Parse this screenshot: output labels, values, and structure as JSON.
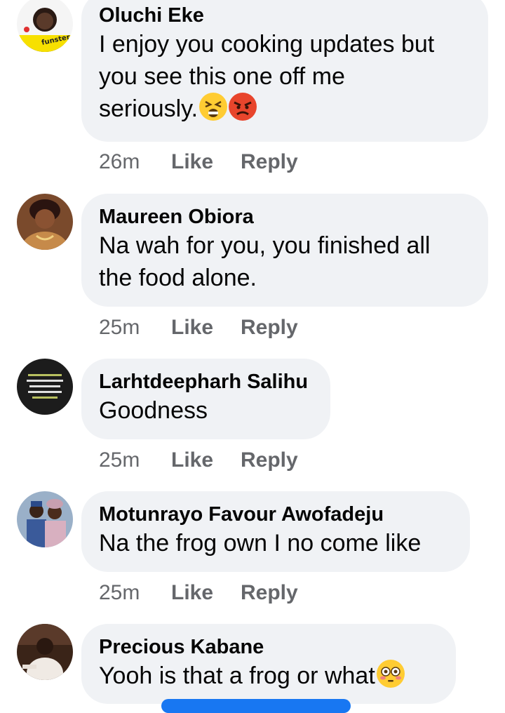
{
  "comments": [
    {
      "name": "Oluchi Eke",
      "text_lines": [
        "I enjoy you cooking updates but",
        "you see this one off me",
        "seriously."
      ],
      "emojis": [
        "tired-face-emoji",
        "angry-face-emoji"
      ],
      "time": "26m",
      "like": "Like",
      "reply": "Reply",
      "avatar": {
        "bg": "#f7e000",
        "label": "funster"
      }
    },
    {
      "name": "Maureen Obiora",
      "text_lines": [
        "Na wah for you, you finished all",
        "the food alone."
      ],
      "time": "25m",
      "like": "Like",
      "reply": "Reply",
      "avatar": {
        "bg": "#6b3a24"
      }
    },
    {
      "name": "Larhtdeepharh Salihu",
      "text_lines": [
        "Goodness"
      ],
      "time": "25m",
      "like": "Like",
      "reply": "Reply",
      "avatar": {
        "bg": "#1c1c1c"
      }
    },
    {
      "name": "Motunrayo Favour Awofadeju",
      "text_lines": [
        "Na the frog own I no come like"
      ],
      "time": "25m",
      "like": "Like",
      "reply": "Reply",
      "avatar": {
        "bg": "#8aa0b8"
      }
    },
    {
      "name": "Precious Kabane",
      "text_lines": [
        "Yooh is that a frog or what"
      ],
      "emojis": [
        "flushed-face-emoji"
      ],
      "avatar": {
        "bg": "#3a2418"
      }
    }
  ],
  "colors": {
    "bubble": "#f0f2f5",
    "meta_text": "#65676b",
    "accent": "#1877f2"
  }
}
